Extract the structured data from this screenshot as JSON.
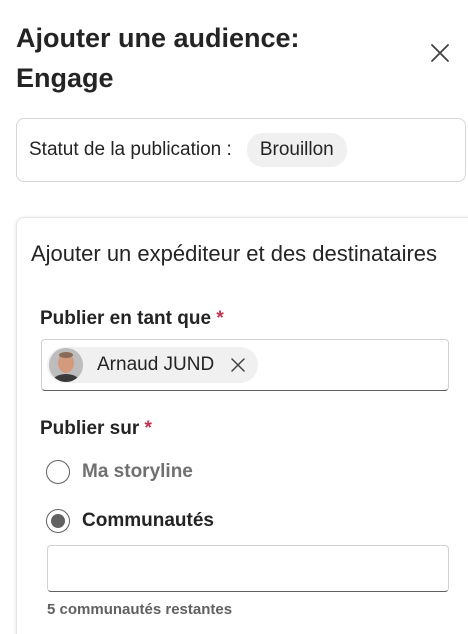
{
  "dialog": {
    "title_line1": "Ajouter une audience:",
    "title_line2": "Engage",
    "close_icon": "close-icon"
  },
  "status": {
    "label": "Statut de la publication :",
    "value": "Brouillon"
  },
  "section": {
    "title": "Ajouter un expéditeur et des destinataires"
  },
  "publish_as": {
    "label": "Publier en tant que",
    "required_mark": "*",
    "person_name": "Arnaud JUND",
    "remove_icon": "close-icon"
  },
  "publish_on": {
    "label": "Publier sur",
    "required_mark": "*",
    "options": [
      {
        "label": "Ma storyline",
        "selected": false
      },
      {
        "label": "Communautés",
        "selected": true
      }
    ],
    "input_value": "",
    "helper": "5 communautés restantes"
  },
  "colors": {
    "required": "#c4314b",
    "border": "#d1d1d1",
    "chip_bg": "#f0f0f0"
  }
}
